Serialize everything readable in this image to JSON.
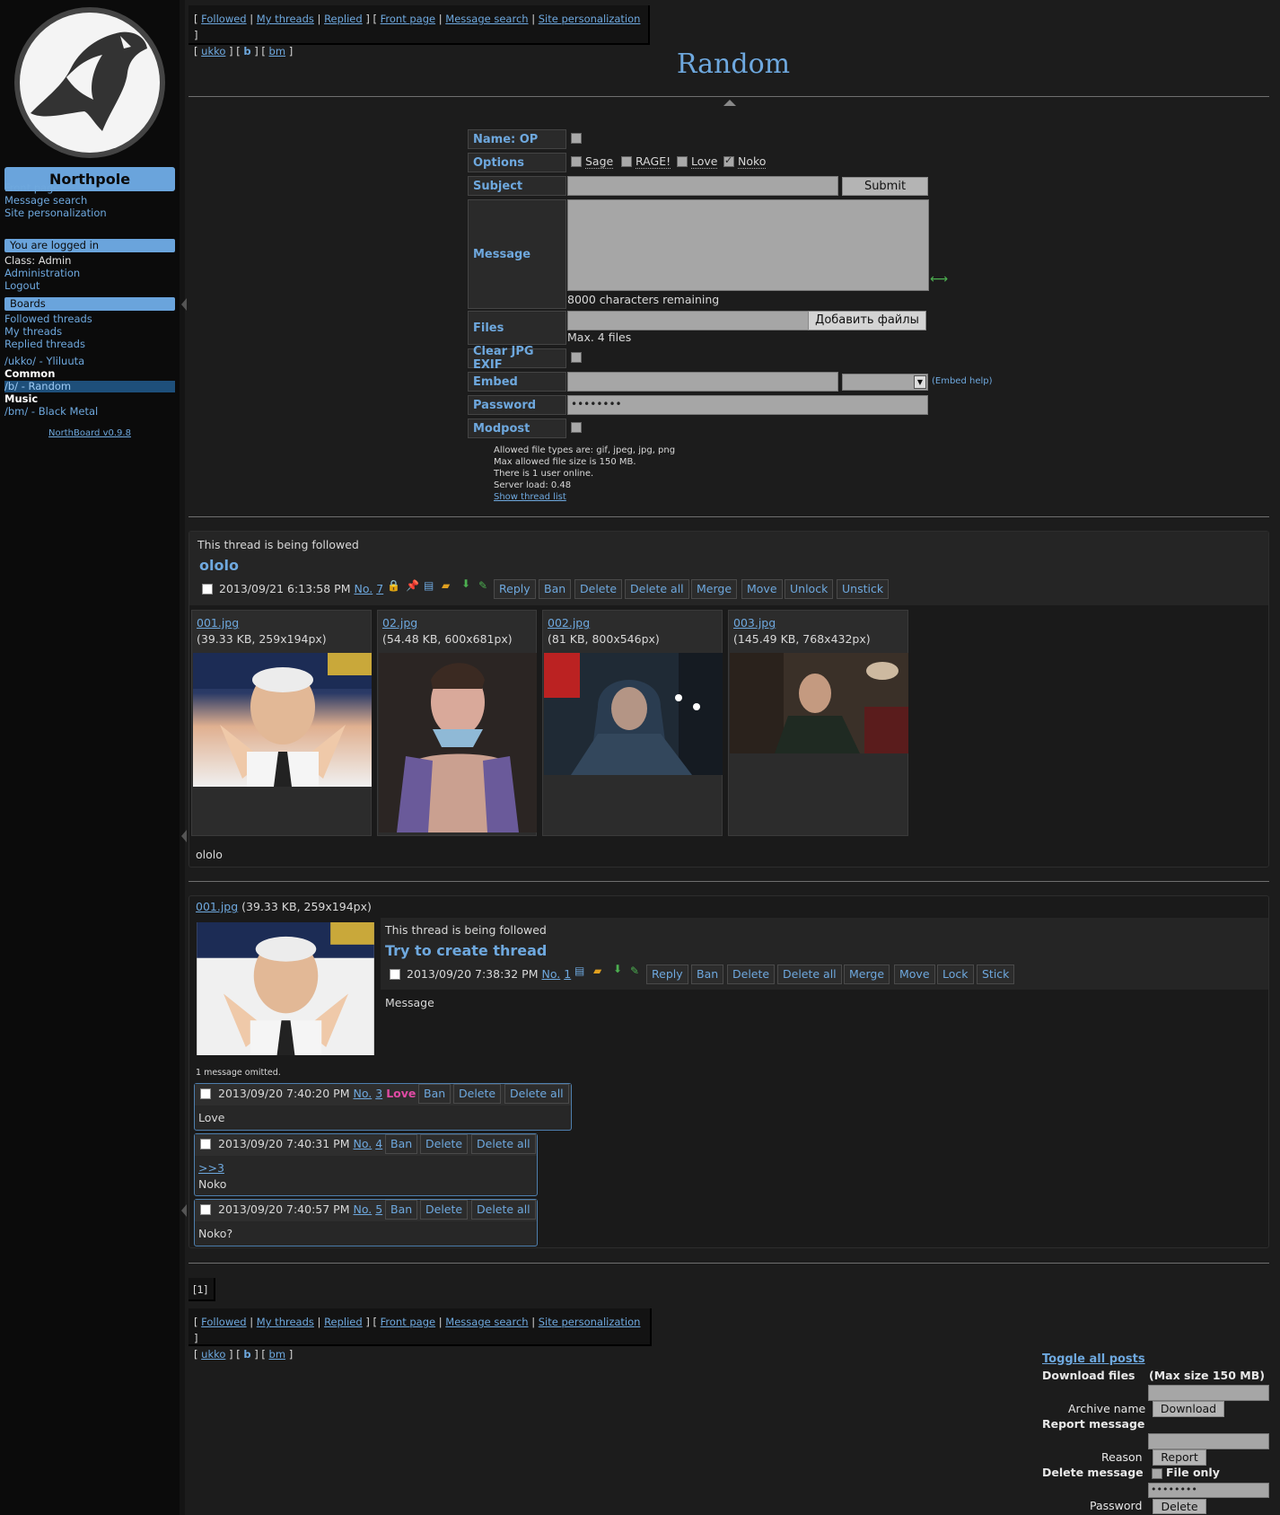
{
  "colors": {
    "accent": "#6ea8de",
    "sidebar_bar": "#6aa4dc",
    "love": "#e04aa4",
    "background": "#1c1c1c"
  },
  "sidebar": {
    "site_title": "Northpole",
    "links": [
      "Front page",
      "Message search",
      "Site personalization"
    ],
    "logged_in": "You are logged in",
    "class_line": "Class: Admin",
    "admin_links": [
      "Administration",
      "Logout"
    ],
    "boards_header": "Boards",
    "thread_links": [
      "Followed threads",
      "My threads",
      "Replied threads"
    ],
    "board_ukko": "/ukko/ - Yliluuta",
    "group_common": "Common",
    "board_b": "/b/ - Random",
    "group_music": "Music",
    "board_bm": "/bm/ - Black Metal",
    "version": "NorthBoard v0.9.8"
  },
  "nav": {
    "followed": "Followed",
    "my_threads": "My threads",
    "replied": "Replied",
    "front_page": "Front page",
    "message_search": "Message search",
    "site_personalization": "Site personalization",
    "ukko": "ukko",
    "b": "b",
    "bm": "bm"
  },
  "board_title": "Random",
  "form": {
    "name_label": "Name: OP",
    "options_label": "Options",
    "opt_sage": "Sage",
    "opt_rage": "RAGE!",
    "opt_love": "Love",
    "opt_noko": "Noko",
    "subject_label": "Subject",
    "submit": "Submit",
    "message_label": "Message",
    "chars_remaining": "8000 characters remaining",
    "files_label": "Files",
    "add_files": "Добавить файлы",
    "max_files": "Max. 4 files",
    "clear_exif_label": "Clear JPG EXIF",
    "embed_label": "Embed",
    "embed_help": "(Embed help)",
    "password_label": "Password",
    "password_value": "••••••••",
    "modpost_label": "Modpost",
    "info": [
      "Allowed file types are: gif, jpeg, jpg, png",
      "Max allowed file size is 150 MB.",
      "There is 1 user online.",
      "Server load: 0.48"
    ],
    "show_thread_list": "Show thread list"
  },
  "thread1": {
    "follow_note": "This thread is being followed",
    "subject": "ololo",
    "time": "2013/09/21 6:13:58 PM",
    "no_label": "No.",
    "no": "7",
    "actions": [
      "Reply",
      "Ban",
      "Delete",
      "Delete all",
      "Merge",
      "Move",
      "Unlock",
      "Unstick"
    ],
    "files": [
      {
        "name": "001.jpg",
        "meta": "(39.33 KB, 259x194px)"
      },
      {
        "name": "02.jpg",
        "meta": "(54.48 KB, 600x681px)"
      },
      {
        "name": "002.jpg",
        "meta": "(81 KB, 800x546px)"
      },
      {
        "name": "003.jpg",
        "meta": "(145.49 KB, 768x432px)"
      }
    ],
    "body": "ololo"
  },
  "thread2": {
    "file_name": "001.jpg",
    "file_meta": "(39.33 KB, 259x194px)",
    "follow_note": "This thread is being followed",
    "subject": "Try to create thread",
    "time": "2013/09/20 7:38:32 PM",
    "no_label": "No.",
    "no": "1",
    "actions": [
      "Reply",
      "Ban",
      "Delete",
      "Delete all",
      "Merge",
      "Move",
      "Lock",
      "Stick"
    ],
    "body": "Message",
    "omitted": "1 message omitted.",
    "replies": [
      {
        "time": "2013/09/20 7:40:20 PM",
        "no": "3",
        "tag": "Love",
        "body": "Love"
      },
      {
        "time": "2013/09/20 7:40:31 PM",
        "no": "4",
        "quote": ">>3",
        "body": "Noko"
      },
      {
        "time": "2013/09/20 7:40:57 PM",
        "no": "5",
        "body": "Noko?"
      }
    ],
    "reply_actions": [
      "Ban",
      "Delete",
      "Delete all"
    ]
  },
  "pagination": "[1]",
  "bottom": {
    "toggle_all": "Toggle all posts",
    "download_files": "Download files",
    "max_size": "(Max size 150 MB)",
    "archive_name": "Archive name",
    "download": "Download",
    "report_message": "Report message",
    "reason": "Reason",
    "report": "Report",
    "delete_message": "Delete message",
    "file_only": "File only",
    "password": "Password",
    "password_value": "••••••••",
    "delete": "Delete"
  }
}
